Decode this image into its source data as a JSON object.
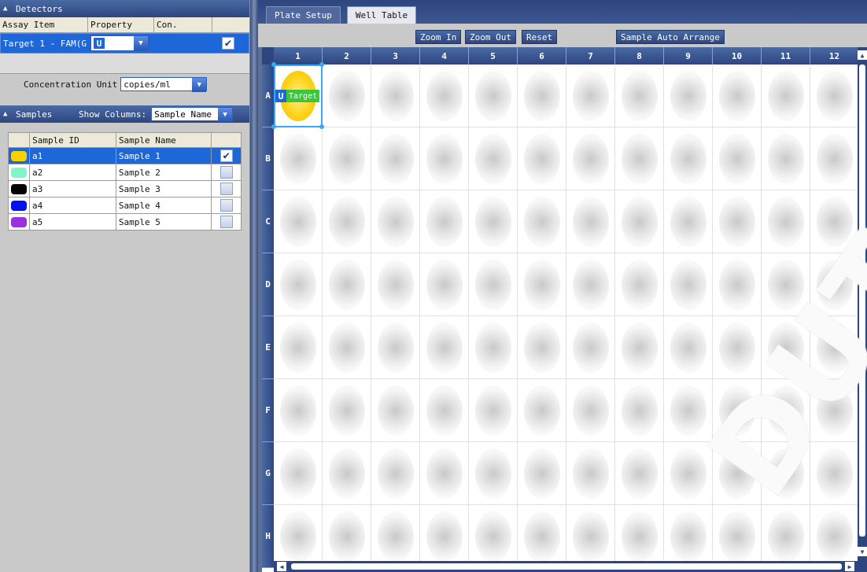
{
  "detectors": {
    "title": "Detectors",
    "columns": [
      "Assay Item",
      "Property",
      "Con."
    ],
    "row": {
      "assay": "Target 1 - FAM(G",
      "property": "U",
      "checked": true
    },
    "concentration_label": "Concentration Unit",
    "concentration_value": "copies/ml"
  },
  "samples": {
    "title": "Samples",
    "show_columns_label": "Show Columns:",
    "show_columns_value": "Sample Name",
    "columns": [
      "Sample ID",
      "Sample Name"
    ],
    "rows": [
      {
        "id": "a1",
        "name": "Sample 1",
        "color": "#f7d300",
        "checked": true
      },
      {
        "id": "a2",
        "name": "Sample 2",
        "color": "#80f5c8",
        "checked": false
      },
      {
        "id": "a3",
        "name": "Sample 3",
        "color": "#000000",
        "checked": false
      },
      {
        "id": "a4",
        "name": "Sample 4",
        "color": "#0010f0",
        "checked": false
      },
      {
        "id": "a5",
        "name": "Sample 5",
        "color": "#9a30e0",
        "checked": false
      }
    ]
  },
  "tabs": [
    "Plate Setup",
    "Well Table"
  ],
  "toolbar": {
    "zoom_in": "Zoom In",
    "zoom_out": "Zoom Out",
    "reset": "Reset",
    "auto_arrange": "Sample Auto Arrange"
  },
  "plate": {
    "columns": [
      "1",
      "2",
      "3",
      "4",
      "5",
      "6",
      "7",
      "8",
      "9",
      "10",
      "11",
      "12"
    ],
    "rows": [
      "A",
      "B",
      "C",
      "D",
      "E",
      "F",
      "G",
      "H"
    ],
    "filled_well": {
      "row": "A",
      "col": "1",
      "property": "U",
      "target": "Target"
    }
  },
  "watermark": "DUTSCHER"
}
